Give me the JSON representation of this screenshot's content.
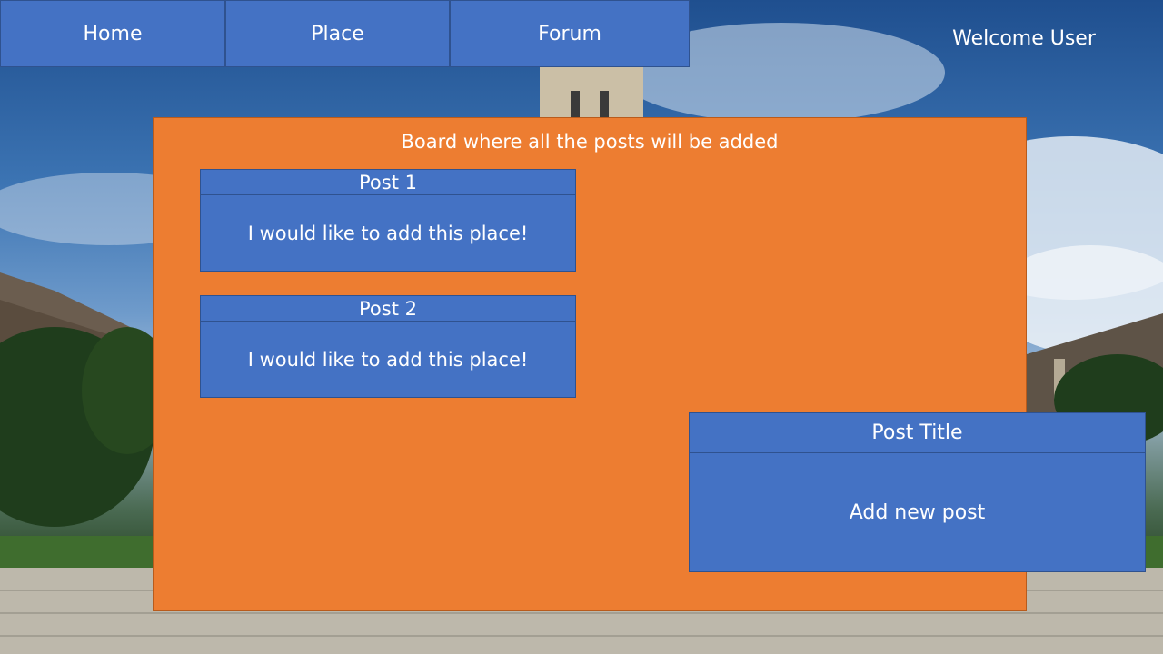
{
  "nav": {
    "items": [
      {
        "label": "Home"
      },
      {
        "label": "Place"
      },
      {
        "label": "Forum"
      }
    ]
  },
  "header": {
    "welcome": "Welcome User"
  },
  "board": {
    "title": "Board where all the posts will be added",
    "posts": [
      {
        "title": "Post 1",
        "body": "I would like to add this place!"
      },
      {
        "title": "Post 2",
        "body": "I would like to add this place!"
      }
    ]
  },
  "new_post": {
    "title": "Post Title",
    "body": "Add new post"
  },
  "colors": {
    "primary_blue": "#4472c4",
    "board_orange": "#ed7d31",
    "text": "#ffffff"
  }
}
